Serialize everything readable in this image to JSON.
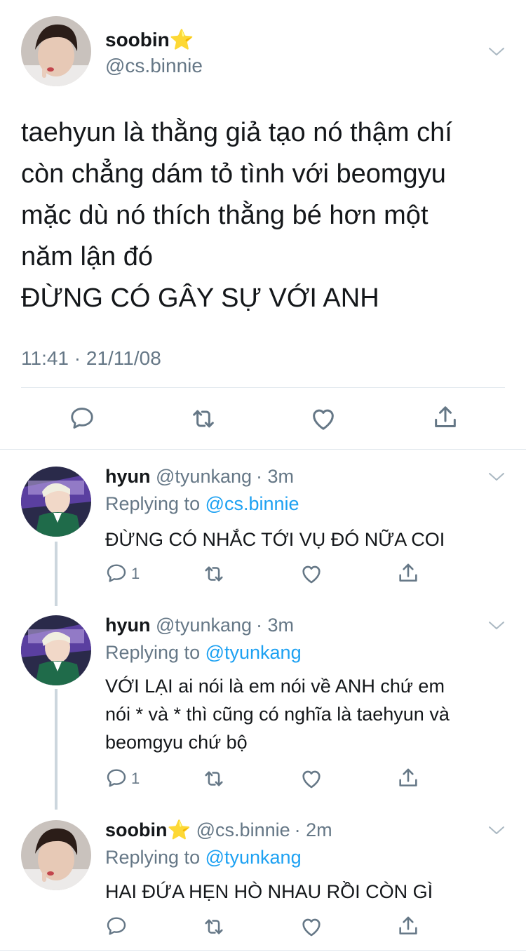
{
  "main_tweet": {
    "display_name": "soobin",
    "name_emoji": "⭐",
    "handle": "@cs.binnie",
    "text_lines": [
      "taehyun là thằng giả tạo nó thậm chí",
      "còn chẳng dám tỏ tình với beomgyu",
      "mặc dù nó thích thằng bé hơn một",
      "năm lận đó",
      "ĐỪNG CÓ GÂY SỰ VỚI ANH"
    ],
    "timestamp": "11:41 · 21/11/08"
  },
  "replies": [
    {
      "display_name": "hyun",
      "handle": "@tyunkang",
      "time": "· 3m",
      "replying_prefix": "Replying to ",
      "replying_to": "@cs.binnie",
      "text_lines": [
        "ĐỪNG CÓ NHẮC TỚI VỤ ĐÓ NỮA COI"
      ],
      "reply_count": "1"
    },
    {
      "display_name": "hyun",
      "handle": "@tyunkang",
      "time": "· 3m",
      "replying_prefix": "Replying to ",
      "replying_to": "@tyunkang",
      "text_lines": [
        "VỚI LẠI ai nói là em nói về ANH chứ em",
        "nói * và * thì cũng có nghĩa là taehyun và",
        "beomgyu chứ bộ"
      ],
      "reply_count": "1"
    },
    {
      "display_name": "soobin",
      "name_emoji": "⭐",
      "handle": "@cs.binnie",
      "time": "· 2m",
      "replying_prefix": "Replying to ",
      "replying_to": "@tyunkang",
      "text_lines": [
        "HAI ĐỨA HẸN HÒ NHAU RỒI CÒN GÌ"
      ],
      "reply_count": ""
    }
  ],
  "icons": {
    "reply": "reply-icon",
    "retweet": "retweet-icon",
    "like": "heart-icon",
    "share": "share-icon",
    "menu": "chevron-down-icon"
  },
  "colors": {
    "text": "#14171a",
    "secondary": "#657786",
    "link": "#1da1f2",
    "divider": "#e1e8ed",
    "thread_line": "#ccd6dd"
  }
}
